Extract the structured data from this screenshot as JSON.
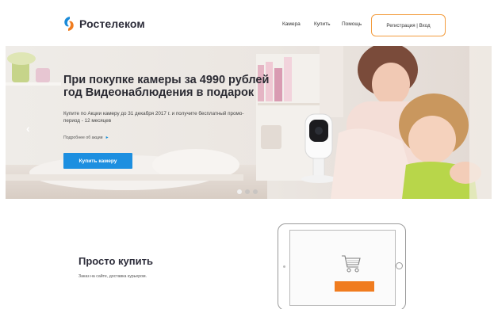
{
  "header": {
    "logo_text": "Ростелеком",
    "nav": {
      "camera": "Камера",
      "buy": "Купить",
      "help": "Помощь"
    },
    "auth_label": "Регистрация | Вход"
  },
  "hero": {
    "title_line1": "При покупке камеры за 4990 рублей",
    "title_line2": "год Видеонаблюдения в подарок",
    "subtitle": "Купите по Акции камеру до 31 декабря 2017 г. и получите бесплатный промо-период - 12 месяцев",
    "more_link": "Подробнее об акции",
    "more_arrow": "▸",
    "cta_button": "Купить камеру",
    "prev_arrow": "‹",
    "slides_count": 3,
    "active_slide": 1
  },
  "section": {
    "title": "Просто купить",
    "subtitle": "Заказ на сайте, доставка курьером."
  },
  "colors": {
    "brand_orange": "#f39c3e",
    "cta_blue": "#1d8fe0",
    "bar_orange": "#f07c1f",
    "logo_blue": "#1a8ad8"
  },
  "icons": {
    "logo": "rostelecom-logo-icon",
    "cart": "shopping-cart-icon"
  }
}
